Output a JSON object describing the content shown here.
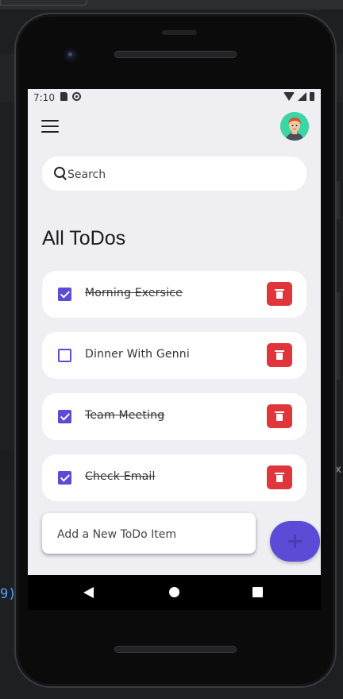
{
  "host": {
    "code_fragment": "9)",
    "close_glyph": "x"
  },
  "status_bar": {
    "time": "7:10"
  },
  "search": {
    "placeholder": "Search"
  },
  "page": {
    "title": "All ToDos"
  },
  "todos": [
    {
      "text": "Morning Exersice",
      "done": true
    },
    {
      "text": "Dinner With Genni",
      "done": false
    },
    {
      "text": "Team Meeting",
      "done": true
    },
    {
      "text": "Check Email",
      "done": true
    }
  ],
  "add_form": {
    "placeholder": "Add a New ToDo Item",
    "add_label": "+"
  },
  "colors": {
    "accent": "#5b4bd6",
    "delete": "#e0353b",
    "background": "#eeeef3",
    "avatar_bg": "#3cd6a6"
  },
  "icons": [
    "menu-icon",
    "avatar",
    "search-icon",
    "checkbox",
    "trash-icon",
    "plus-icon",
    "back-icon",
    "home-icon",
    "recents-icon",
    "wifi-icon",
    "signal-icon",
    "battery-icon"
  ]
}
